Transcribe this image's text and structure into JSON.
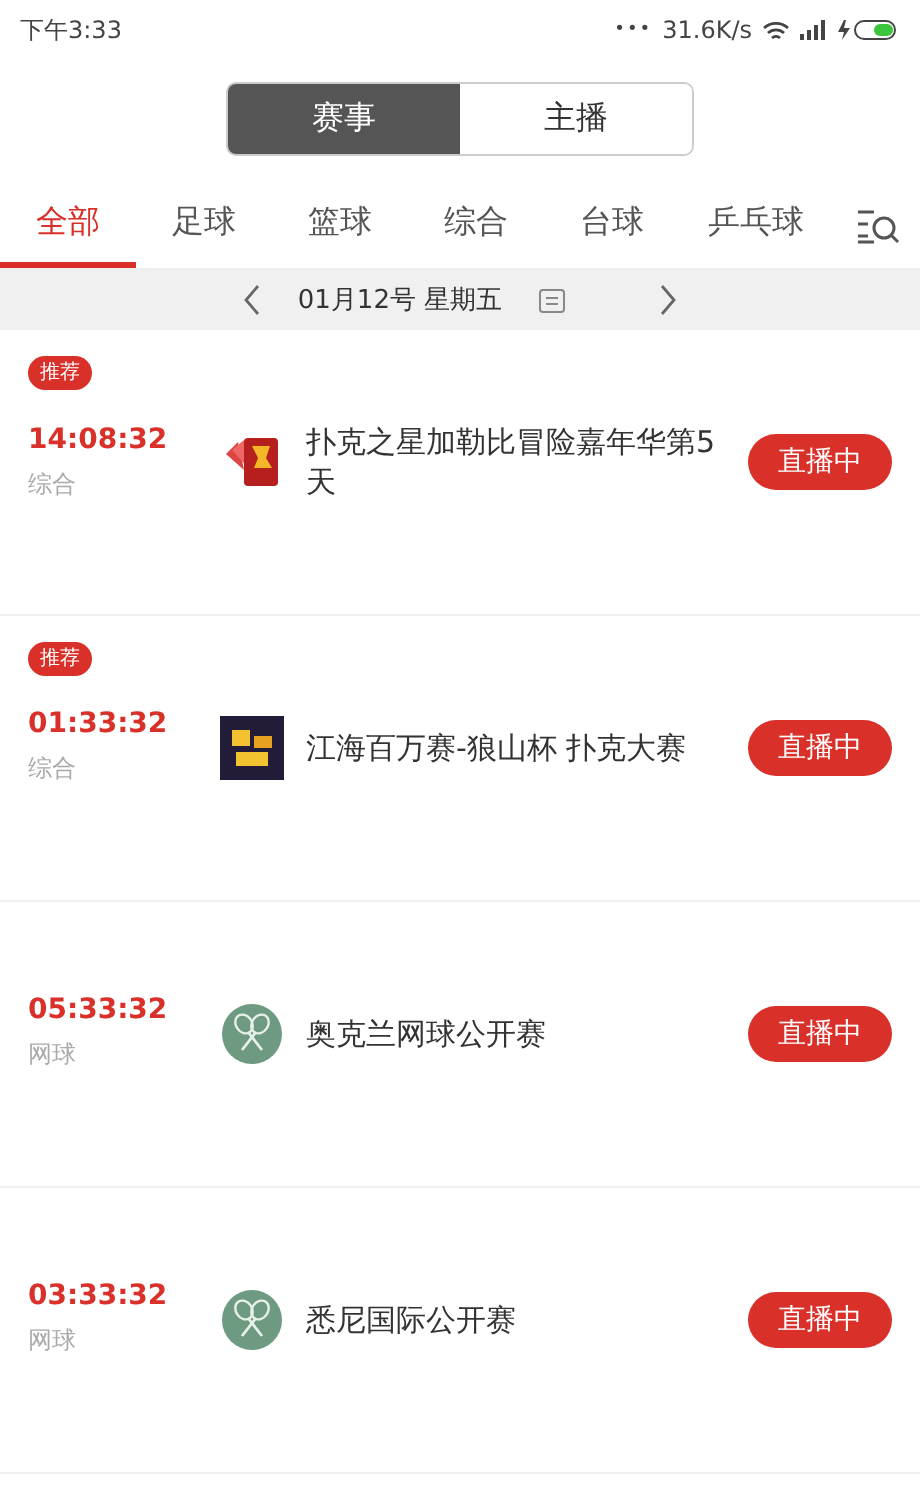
{
  "status_bar": {
    "time": "下午3:33",
    "dots": "•••",
    "speed": "31.6K/s"
  },
  "segments": [
    {
      "label": "赛事",
      "selected": true
    },
    {
      "label": "主播",
      "selected": false
    }
  ],
  "tabs": [
    {
      "label": "全部",
      "selected": true
    },
    {
      "label": "足球",
      "selected": false
    },
    {
      "label": "篮球",
      "selected": false
    },
    {
      "label": "综合",
      "selected": false
    },
    {
      "label": "台球",
      "selected": false
    },
    {
      "label": "乒乓球",
      "selected": false
    }
  ],
  "date_bar": {
    "date": "01月12号 星期五"
  },
  "events": [
    {
      "badge": "推荐",
      "time": "14:08:32",
      "category": "综合",
      "logo": {
        "kind": "cards"
      },
      "title": "扑克之星加勒比冒险嘉年华第5天",
      "status": "直播中"
    },
    {
      "badge": "推荐",
      "time": "01:33:32",
      "category": "综合",
      "logo": {
        "kind": "poster"
      },
      "title": "江海百万赛-狼山杯 扑克大赛",
      "status": "直播中"
    },
    {
      "time": "05:33:32",
      "category": "网球",
      "logo": {
        "kind": "tennis"
      },
      "title": "奥克兰网球公开赛",
      "status": "直播中"
    },
    {
      "time": "03:33:32",
      "category": "网球",
      "logo": {
        "kind": "tennis"
      },
      "title": "悉尼国际公开赛",
      "status": "直播中"
    }
  ]
}
